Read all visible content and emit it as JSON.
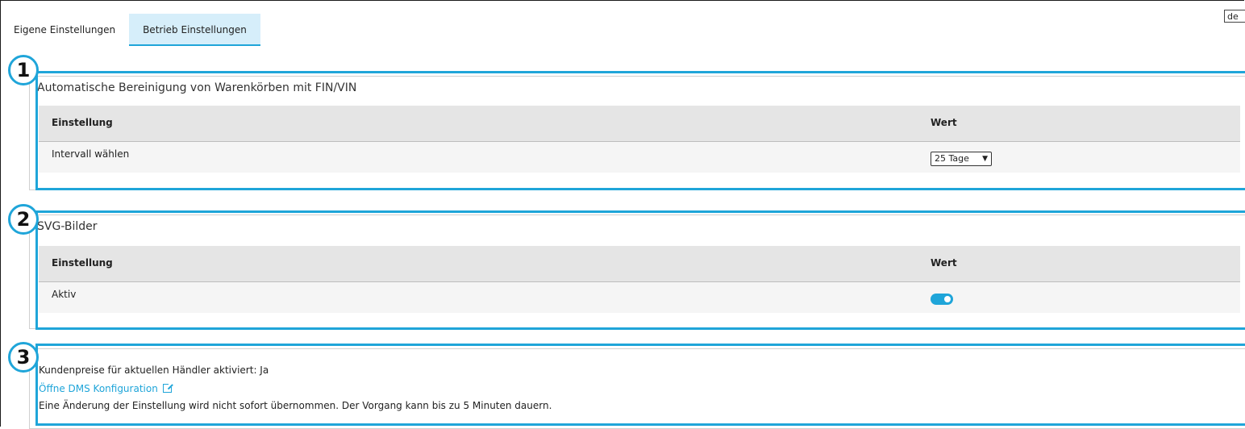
{
  "tabs": [
    {
      "label": "Eigene Einstellungen",
      "active": false
    },
    {
      "label": "Betrieb Einstellungen",
      "active": true
    }
  ],
  "language": {
    "value": "de"
  },
  "sections": [
    {
      "badge": "1",
      "title": "Automatische Bereinigung von Warenkörben mit FIN/VIN",
      "header": {
        "setting": "Einstellung",
        "value": "Wert"
      },
      "row": {
        "label": "Intervall wählen",
        "control": "select",
        "selected": "25 Tage"
      }
    },
    {
      "badge": "2",
      "title": "SVG-Bilder",
      "header": {
        "setting": "Einstellung",
        "value": "Wert"
      },
      "row": {
        "label": "Aktiv",
        "control": "toggle",
        "enabled": true
      }
    },
    {
      "badge": "3",
      "lines": {
        "prices": "Kundenpreise für aktuellen Händler aktiviert:  Ja",
        "link": "Öffne DMS Konfiguration",
        "note": "Eine Änderung der Einstellung wird nicht sofort übernommen. Der Vorgang kann bis zu 5 Minuten dauern."
      }
    }
  ],
  "colors": {
    "accent": "#1fa5d9",
    "header_bg": "#e5e5e5",
    "row_bg": "#f5f5f5",
    "active_tab_bg": "#d6eefa"
  },
  "icons": {
    "external_link": "external-link-icon",
    "select_chevron": "chevron-down-icon"
  }
}
